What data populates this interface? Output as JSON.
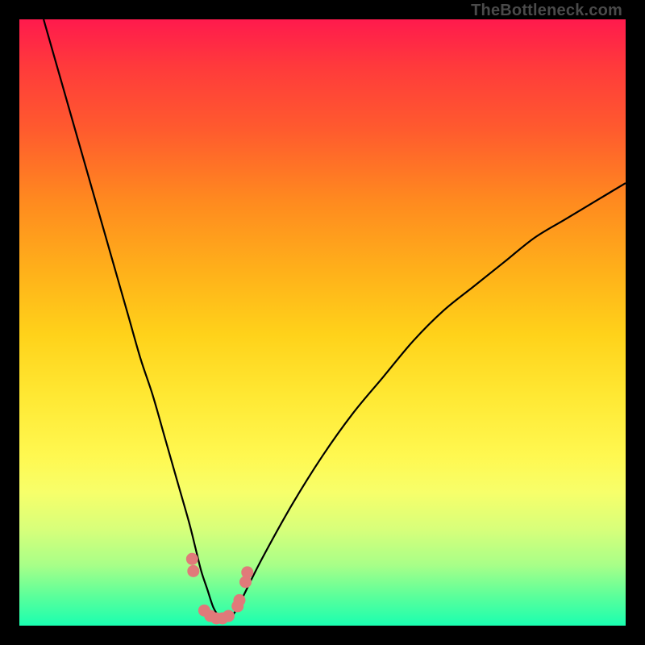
{
  "watermark": "TheBottleneck.com",
  "chart_data": {
    "type": "line",
    "title": "",
    "xlabel": "",
    "ylabel": "",
    "xlim": [
      0,
      100
    ],
    "ylim": [
      0,
      100
    ],
    "series": [
      {
        "name": "bottleneck-curve",
        "x": [
          4,
          6,
          8,
          10,
          12,
          14,
          16,
          18,
          20,
          22,
          24,
          26,
          28,
          29,
          30,
          31,
          32,
          33,
          34,
          35,
          36,
          37,
          40,
          45,
          50,
          55,
          60,
          65,
          70,
          75,
          80,
          85,
          90,
          95,
          100
        ],
        "values": [
          100,
          93,
          86,
          79,
          72,
          65,
          58,
          51,
          44,
          38,
          31,
          24,
          17,
          13,
          9,
          6,
          3,
          1.5,
          1,
          1.5,
          3,
          5,
          11,
          20,
          28,
          35,
          41,
          47,
          52,
          56,
          60,
          64,
          67,
          70,
          73
        ]
      }
    ],
    "markers": {
      "name": "valley-markers",
      "color": "#e07a7a",
      "x": [
        28.5,
        28.7,
        30.5,
        31.5,
        32.5,
        33.5,
        34.5,
        36.0,
        36.3,
        37.3,
        37.6
      ],
      "values": [
        11,
        9,
        2.5,
        1.6,
        1.2,
        1.2,
        1.6,
        3.2,
        4.2,
        7.2,
        8.8
      ]
    },
    "gradient_stops": [
      {
        "pos": 0,
        "color": "#ff1a4d"
      },
      {
        "pos": 50,
        "color": "#ffe833"
      },
      {
        "pos": 100,
        "color": "#1affb0"
      }
    ]
  }
}
